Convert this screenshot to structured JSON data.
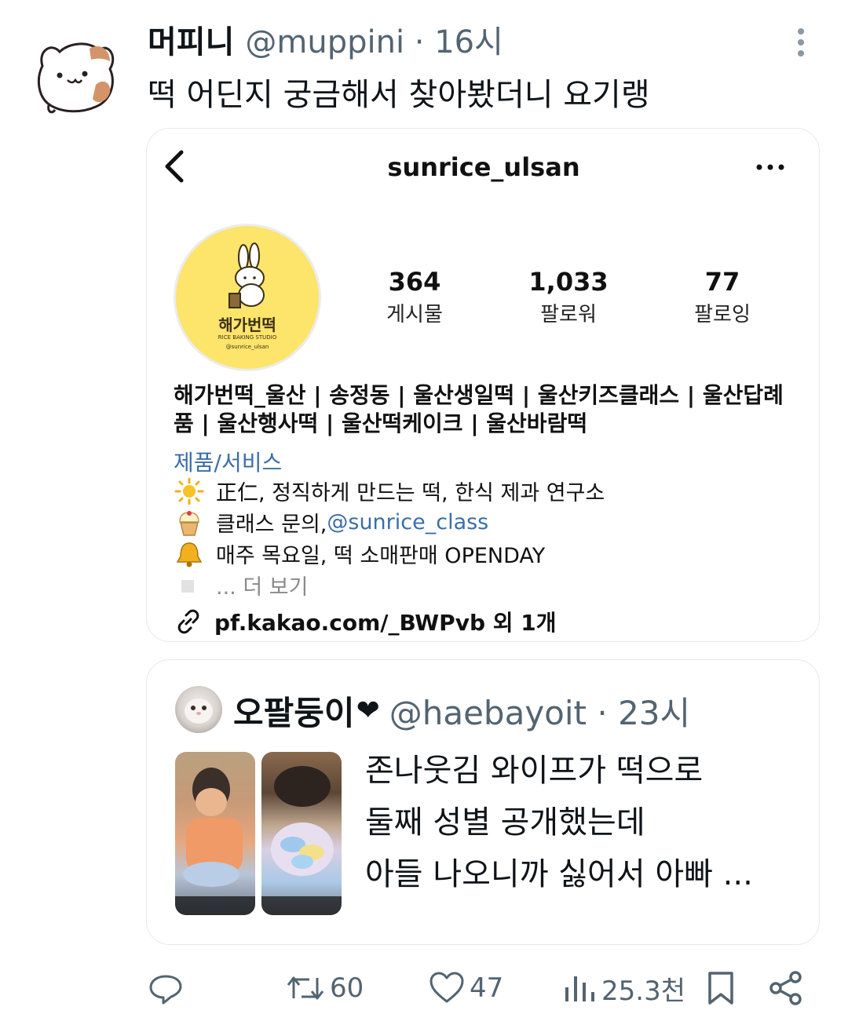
{
  "tweet": {
    "display_name": "머피니",
    "meta": "@muppini · 16시",
    "text": "떡 어딘지 궁금해서 찾아봤더니 요기랭"
  },
  "instagram": {
    "username": "sunrice_ulsan",
    "logo_text": "해가번떡",
    "logo_sub": "RICE BAKING STUDIO",
    "logo_handle": "@sunrice_ulsan",
    "stats": [
      {
        "num": "364",
        "label": "게시물"
      },
      {
        "num": "1,033",
        "label": "팔로워"
      },
      {
        "num": "77",
        "label": "팔로잉"
      }
    ],
    "bio": "해가번떡_울산 | 송정동 | 울산생일떡 | 울산키즈클래스 | 울산답례품 | 울산행사떡 | 울산떡케이크 | 울산바람떡",
    "category": "제품/서비스",
    "line1": "正仁, 정직하게 만드는 떡, 한식 제과 연구소",
    "line2_prefix": "클래스 문의, ",
    "line2_mention": "@sunrice_class",
    "line3": "매주 목요일, 떡 소매판매 OPENDAY",
    "line4": "... 더 보기",
    "link": "pf.kakao.com/_BWPvb 외 1개"
  },
  "quote": {
    "display_name": "오팔둥이",
    "heart": "❤",
    "meta": "@haebayoit · 23시",
    "text_lines": [
      "존나웃김 와이프가 떡으로",
      "둘째 성별 공개했는데",
      "아들 나오니까 싫어서 아빠 ..."
    ]
  },
  "actions": {
    "retweets": "60",
    "likes": "47",
    "views": "25.3천"
  },
  "colors": {
    "text": "#0f1419",
    "secondary": "#536471",
    "ig_link": "#3b6ea8",
    "ig_avatar_bg": "#fde46a"
  },
  "icons": [
    "more-vert-icon",
    "back-arrow-icon",
    "more-horiz-icon",
    "sun-icon",
    "cupcake-icon",
    "bell-icon",
    "link-icon",
    "reply-icon",
    "retweet-icon",
    "like-icon",
    "views-icon",
    "bookmark-icon",
    "share-icon"
  ]
}
